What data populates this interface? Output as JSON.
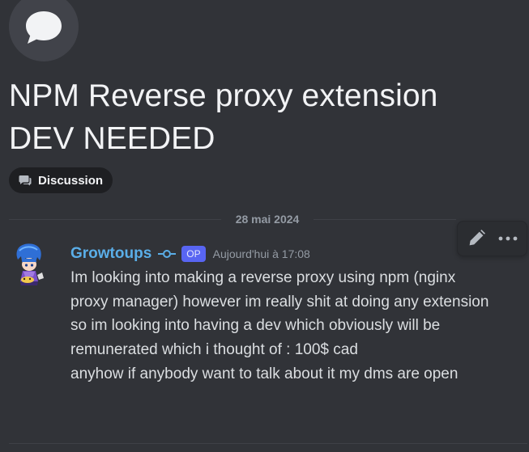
{
  "thread": {
    "icon": "chat-bubble-icon",
    "title": "NPM Reverse proxy extension DEV NEEDED",
    "tag": {
      "icon": "discussion-icon",
      "label": "Discussion"
    }
  },
  "date_divider": "28 mai 2024",
  "hover_actions": {
    "edit_icon": "pencil-icon",
    "more_icon": "more-options-icon"
  },
  "message": {
    "author": "Growtoups",
    "role_icon": "role-commit-icon",
    "op_label": "OP",
    "timestamp": "Aujourd'hui à 17:08",
    "body": [
      "Im looking into making a reverse proxy using npm (nginx proxy manager) however im really shit at doing any extension so im looking into having a dev which obviously will be remunerated which i thought of : 100$ cad",
      "anyhow if anybody want to talk about it my dms are open"
    ]
  },
  "colors": {
    "background": "#313338",
    "username": "#5aaee8",
    "op_badge": "#5865f2",
    "text": "#dbdee1",
    "muted": "#949ba4"
  }
}
